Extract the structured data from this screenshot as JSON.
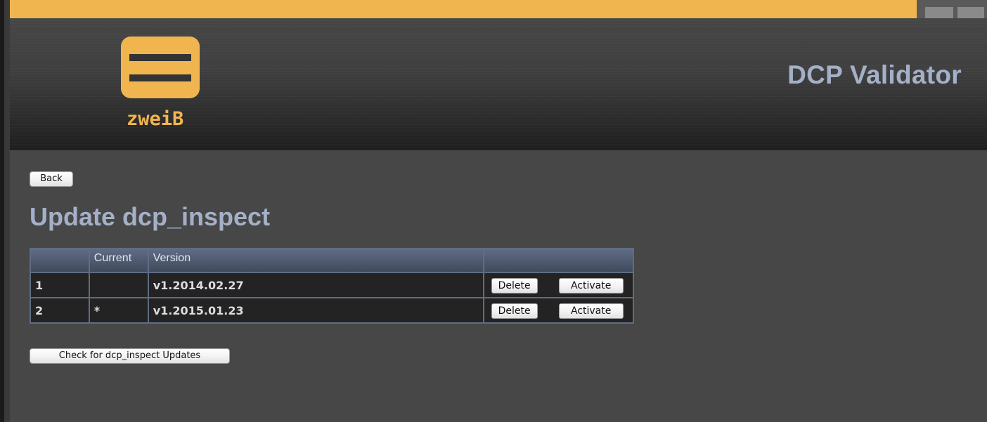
{
  "header": {
    "logo_text": "zweiB",
    "app_title": "DCP Validator"
  },
  "main": {
    "back_label": "Back",
    "page_title": "Update dcp_inspect",
    "table": {
      "columns": [
        "",
        "Current",
        "Version",
        ""
      ],
      "rows": [
        {
          "num": "1",
          "current": "",
          "version": "v1.2014.02.27",
          "delete_label": "Delete",
          "activate_label": "Activate"
        },
        {
          "num": "2",
          "current": "*",
          "version": "v1.2015.01.23",
          "delete_label": "Delete",
          "activate_label": "Activate"
        }
      ]
    },
    "check_updates_label": "Check for dcp_inspect Updates"
  },
  "colors": {
    "accent_orange": "#f1b54f",
    "title_blue_gray": "#a4b0c8",
    "background": "#474747",
    "table_border": "#5f6d85"
  }
}
